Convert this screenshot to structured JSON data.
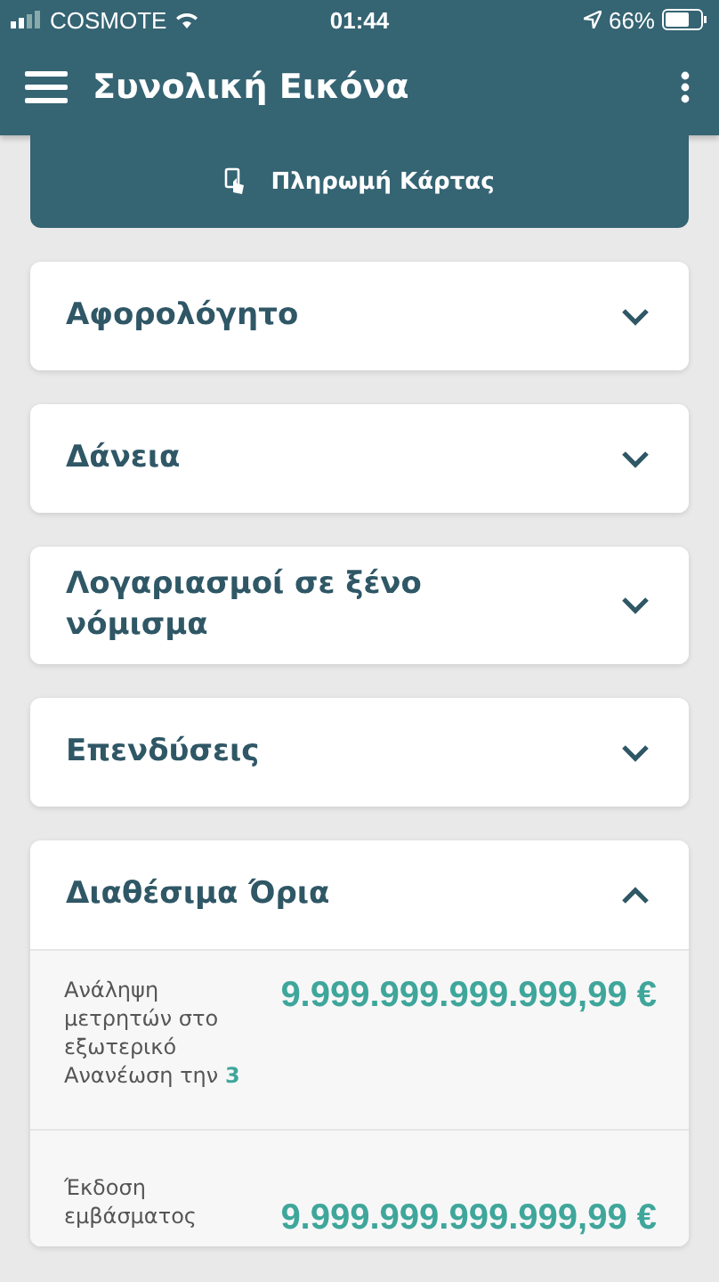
{
  "status_bar": {
    "carrier": "COSMOTE",
    "time": "01:44",
    "battery": "66%"
  },
  "app_bar": {
    "title": "Συνολική Εικόνα"
  },
  "payment_button": {
    "label": "Πληρωμή Κάρτας"
  },
  "sections": [
    {
      "title": "Αφορολόγητο",
      "expanded": false
    },
    {
      "title": "Δάνεια",
      "expanded": false
    },
    {
      "title": "Λογαριασμοί σε ξένο νόμισμα",
      "expanded": false
    },
    {
      "title": "Επενδύσεις",
      "expanded": false
    },
    {
      "title": "Διαθέσιμα Όρια",
      "expanded": true,
      "rows": [
        {
          "label": "Ανάληψη μετρητών στο εξωτερικό",
          "renewal": "Ανανέωση την",
          "renewal_day": "3",
          "amount": "9.999.999.999.999,99 €"
        },
        {
          "label": "Έκδοση εμβάσματος",
          "amount": "9.999.999.999.999,99 €"
        }
      ]
    }
  ]
}
